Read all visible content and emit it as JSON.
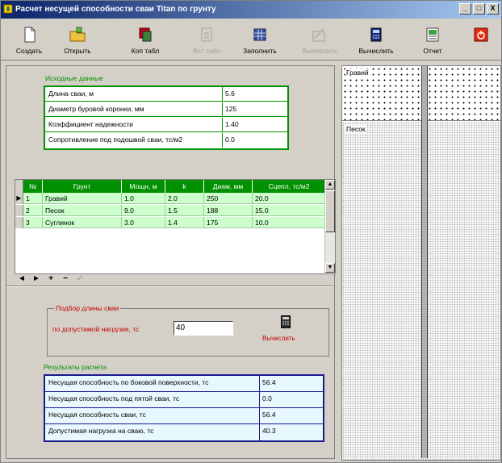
{
  "window": {
    "title": "Расчет несущей способности сваи Titan по грунту",
    "controls": [
      "_",
      "□",
      "X"
    ]
  },
  "toolbar": {
    "items": [
      {
        "label": "Создать",
        "icon": "new-document-icon",
        "enabled": true
      },
      {
        "label": "Открыть",
        "icon": "open-folder-icon",
        "enabled": true
      },
      {
        "label": "Коп табл",
        "icon": "copy-table-icon",
        "enabled": true
      },
      {
        "label": "Вст табл",
        "icon": "paste-table-icon",
        "enabled": false
      },
      {
        "label": "Заполнить",
        "icon": "fill-table-icon",
        "enabled": true
      },
      {
        "label": "Вычислить",
        "icon": "compute-disabled-icon",
        "enabled": false
      },
      {
        "label": "Вычислить",
        "icon": "calculator-icon",
        "enabled": true
      },
      {
        "label": "Отчет",
        "icon": "report-icon",
        "enabled": true
      },
      {
        "label": "",
        "icon": "exit-icon",
        "enabled": true
      }
    ]
  },
  "input_section": {
    "title": "Исходные данные",
    "rows": [
      {
        "label": "Длина сваи, м",
        "value": "5.6"
      },
      {
        "label": "Диаметр буровой коронки, мм",
        "value": "125"
      },
      {
        "label": "Коэффициент надежности",
        "value": "1.40"
      },
      {
        "label": "Сопротивление под подошвой сваи, тс/м2",
        "value": "0.0"
      }
    ]
  },
  "soil_table": {
    "columns": [
      "№",
      "Грунт",
      "Мощн, м",
      "k",
      "Диам, мм",
      "Сцепл, тс/м2"
    ],
    "rows": [
      [
        "1",
        "Гравий",
        "1.0",
        "2.0",
        "250",
        "20.0"
      ],
      [
        "2",
        "Песок",
        "9.0",
        "1.5",
        "188",
        "15.0"
      ],
      [
        "3",
        "Суглинок",
        "3.0",
        "1.4",
        "175",
        "10.0"
      ]
    ],
    "current_row_marker": "▶",
    "nav": [
      "◄",
      "►",
      "+",
      "−",
      "✓"
    ]
  },
  "pile_length": {
    "title": "Подбор длины сваи",
    "label": "по допустимой нагрузке, тс",
    "value": "40",
    "button_label": "Вычислить"
  },
  "results": {
    "title": "Результаты расчета",
    "rows": [
      {
        "label": "Несущая способность по боковой поверхности, тс",
        "value": "56.4"
      },
      {
        "label": "Несущая способность под пятой сваи, тс",
        "value": "0.0"
      },
      {
        "label": "Несущая способность сваи, тс",
        "value": "56.4"
      },
      {
        "label": "Допустимая нагрузка на сваю, тс",
        "value": "40.3"
      }
    ]
  },
  "diagram": {
    "layers": [
      "Гравий",
      "Песок"
    ]
  },
  "colors": {
    "accent_green": "#009000",
    "row_green": "#ccffcc",
    "result_blue": "#1a1a90",
    "red_text": "#c00000"
  }
}
